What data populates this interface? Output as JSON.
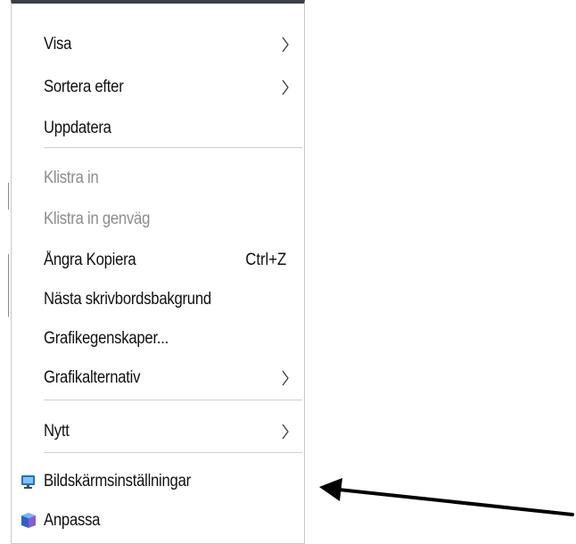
{
  "context_menu": {
    "items": [
      {
        "label": "Visa",
        "shortcut": "",
        "submenu": true,
        "disabled": false
      },
      {
        "label": "Sortera efter",
        "shortcut": "",
        "submenu": true,
        "disabled": false
      },
      {
        "label": "Uppdatera",
        "shortcut": "",
        "submenu": false,
        "disabled": false
      },
      {
        "label": "Klistra in",
        "shortcut": "",
        "submenu": false,
        "disabled": true
      },
      {
        "label": "Klistra in genväg",
        "shortcut": "",
        "submenu": false,
        "disabled": true
      },
      {
        "label": "Ångra Kopiera",
        "shortcut": "Ctrl+Z",
        "submenu": false,
        "disabled": false
      },
      {
        "label": "Nästa skrivbordsbakgrund",
        "shortcut": "",
        "submenu": false,
        "disabled": false
      },
      {
        "label": "Grafikegenskaper...",
        "shortcut": "",
        "submenu": false,
        "disabled": false
      },
      {
        "label": "Grafikalternativ",
        "shortcut": "",
        "submenu": true,
        "disabled": false
      },
      {
        "label": "Nytt",
        "shortcut": "",
        "submenu": true,
        "disabled": false
      },
      {
        "label": "Bildskärmsinställningar",
        "shortcut": "",
        "submenu": false,
        "disabled": false,
        "icon": "display-icon"
      },
      {
        "label": "Anpassa",
        "shortcut": "",
        "submenu": false,
        "disabled": false,
        "icon": "personalize-icon"
      }
    ]
  },
  "annotation": {
    "arrow_color": "#000000"
  },
  "colors": {
    "menu_bg": "#ffffff",
    "text": "#111111",
    "disabled_text": "#8c8c8c",
    "separator": "#cfcfcf",
    "top_bar": "#3c3f47"
  }
}
